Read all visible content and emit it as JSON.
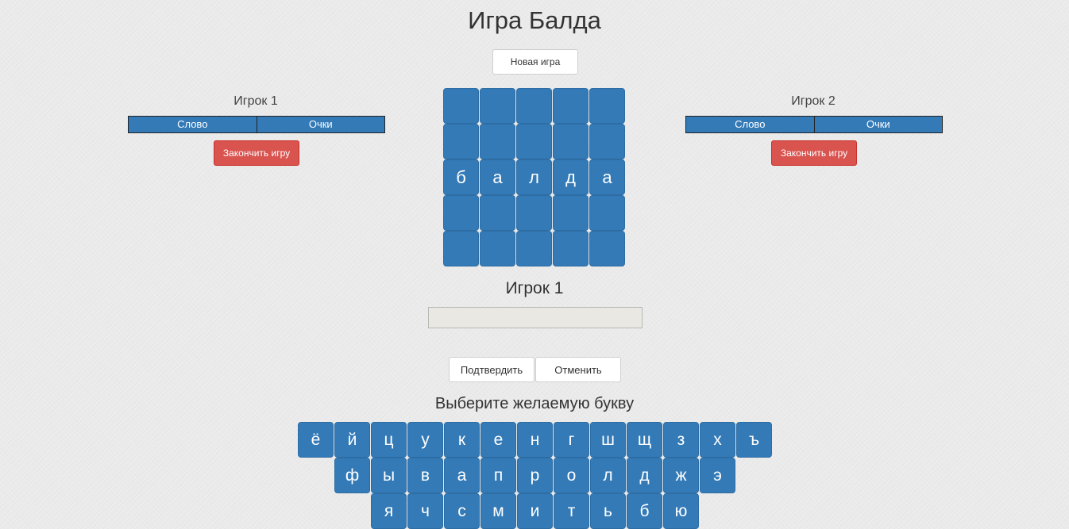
{
  "page": {
    "title": "Игра Балда"
  },
  "toolbar": {
    "new_game_label": "Новая игра"
  },
  "players": [
    {
      "name": "Игрок 1",
      "columns": [
        "Слово",
        "Очки"
      ],
      "end_label": "Закончить игру"
    },
    {
      "name": "Игрок 2",
      "columns": [
        "Слово",
        "Очки"
      ],
      "end_label": "Закончить игру"
    }
  ],
  "board": {
    "rows": [
      [
        "",
        "",
        "",
        "",
        ""
      ],
      [
        "",
        "",
        "",
        "",
        ""
      ],
      [
        "б",
        "а",
        "л",
        "д",
        "а"
      ],
      [
        "",
        "",
        "",
        "",
        ""
      ],
      [
        "",
        "",
        "",
        "",
        ""
      ]
    ]
  },
  "turn": {
    "current_player": "Игрок 1",
    "word_value": ""
  },
  "actions": {
    "confirm_label": "Подтвердить",
    "cancel_label": "Отменить"
  },
  "keyboard": {
    "label": "Выберите желаемую букву",
    "rows": [
      [
        "ё",
        "й",
        "ц",
        "у",
        "к",
        "е",
        "н",
        "г",
        "ш",
        "щ",
        "з",
        "х",
        "ъ"
      ],
      [
        "ф",
        "ы",
        "в",
        "а",
        "п",
        "р",
        "о",
        "л",
        "д",
        "ж",
        "э"
      ],
      [
        "я",
        "ч",
        "с",
        "м",
        "и",
        "т",
        "ь",
        "б",
        "ю"
      ]
    ]
  },
  "colors": {
    "tile": "#337ab7",
    "danger": "#d9534f",
    "background": "#ececec"
  }
}
